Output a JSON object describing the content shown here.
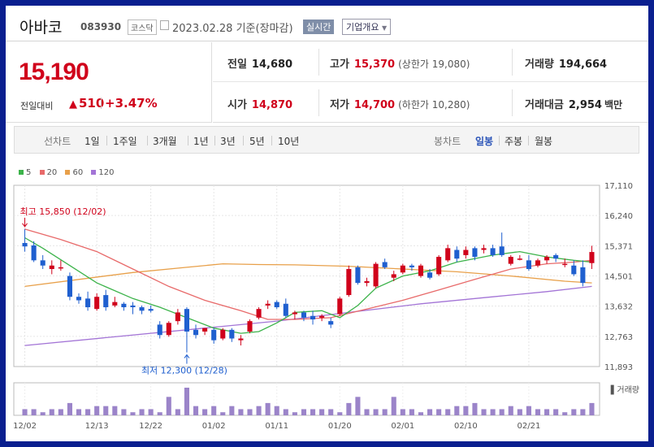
{
  "header": {
    "name": "아바코",
    "code": "083930",
    "market": "코스닥",
    "date": "2023.02.28",
    "basis": "기준(장마감)",
    "realtime_label": "실시간",
    "company_label": "기업개요"
  },
  "price": {
    "current": "15,190",
    "change_label": "전일대비",
    "change_value": "510",
    "change_percent": "+3.47%"
  },
  "stats": {
    "prev_close": {
      "label": "전일",
      "value": "14,680"
    },
    "high": {
      "label": "고가",
      "value": "15,370",
      "limit_label": "(상한가",
      "limit_value": "19,080)"
    },
    "volume": {
      "label": "거래량",
      "value": "194,664"
    },
    "open": {
      "label": "시가",
      "value": "14,870"
    },
    "low": {
      "label": "저가",
      "value": "14,700",
      "limit_label": "(하한가",
      "limit_value": "10,280)"
    },
    "trade_value": {
      "label": "거래대금",
      "value": "2,954",
      "unit": "백만"
    }
  },
  "tabs": {
    "line_label": "선차트",
    "periods": [
      "1일",
      "1주일",
      "3개월",
      "1년",
      "3년",
      "5년",
      "10년"
    ],
    "candle_label": "봉차트",
    "candles": [
      "일봉",
      "주봉",
      "월봉"
    ],
    "active_candle": "일봉"
  },
  "colors": {
    "up": "#d0021b",
    "down": "#1f5fcf",
    "ma5": "#3cb34a",
    "ma20": "#e86a6a",
    "ma60": "#e8a04a",
    "ma120": "#a374d6",
    "volume": "#9b84c9"
  },
  "chart_data": {
    "type": "candlestick",
    "legend": [
      "5",
      "20",
      "60",
      "120"
    ],
    "y_ticks": [
      "17,110",
      "16,240",
      "15,371",
      "14,501",
      "13,632",
      "12,763",
      "11,893"
    ],
    "ylim": [
      11893,
      17110
    ],
    "x_ticks": [
      "12/02",
      "12/13",
      "12/22",
      "01/02",
      "01/11",
      "01/20",
      "02/01",
      "02/10",
      "02/21"
    ],
    "volume_label": "거래량",
    "annotations": {
      "high": {
        "text": "최고 15,850 (12/02)",
        "value": 15850,
        "index": 0
      },
      "low": {
        "text": "최저 12,300 (12/28)",
        "value": 12300,
        "index": 18
      }
    },
    "candles": [
      {
        "o": 15450,
        "h": 15850,
        "l": 15200,
        "c": 15350
      },
      {
        "o": 15380,
        "h": 15500,
        "l": 14900,
        "c": 14950
      },
      {
        "o": 14950,
        "h": 15100,
        "l": 14700,
        "c": 14800
      },
      {
        "o": 14700,
        "h": 14950,
        "l": 14550,
        "c": 14800
      },
      {
        "o": 14750,
        "h": 14950,
        "l": 14650,
        "c": 14750
      },
      {
        "o": 14500,
        "h": 14600,
        "l": 13800,
        "c": 13900
      },
      {
        "o": 13900,
        "h": 14000,
        "l": 13700,
        "c": 13800
      },
      {
        "o": 13850,
        "h": 14050,
        "l": 13500,
        "c": 13600
      },
      {
        "o": 13550,
        "h": 14000,
        "l": 13500,
        "c": 13900
      },
      {
        "o": 13950,
        "h": 14100,
        "l": 13500,
        "c": 13600
      },
      {
        "o": 13650,
        "h": 13900,
        "l": 13600,
        "c": 13750
      },
      {
        "o": 13700,
        "h": 13750,
        "l": 13500,
        "c": 13600
      },
      {
        "o": 13650,
        "h": 13750,
        "l": 13400,
        "c": 13600
      },
      {
        "o": 13600,
        "h": 13650,
        "l": 13400,
        "c": 13500
      },
      {
        "o": 13550,
        "h": 13650,
        "l": 13450,
        "c": 13500
      },
      {
        "o": 13100,
        "h": 13200,
        "l": 12700,
        "c": 12800
      },
      {
        "o": 12800,
        "h": 13200,
        "l": 12750,
        "c": 13150
      },
      {
        "o": 13200,
        "h": 13550,
        "l": 13100,
        "c": 13450
      },
      {
        "o": 13550,
        "h": 13600,
        "l": 12300,
        "c": 12900
      },
      {
        "o": 12950,
        "h": 13100,
        "l": 12700,
        "c": 12800
      },
      {
        "o": 12900,
        "h": 13000,
        "l": 12800,
        "c": 13000
      },
      {
        "o": 12950,
        "h": 13000,
        "l": 12550,
        "c": 12650
      },
      {
        "o": 12700,
        "h": 13000,
        "l": 12650,
        "c": 12950
      },
      {
        "o": 12950,
        "h": 13000,
        "l": 12600,
        "c": 12700
      },
      {
        "o": 12650,
        "h": 12800,
        "l": 12500,
        "c": 12700
      },
      {
        "o": 12900,
        "h": 13250,
        "l": 12850,
        "c": 13200
      },
      {
        "o": 13300,
        "h": 13600,
        "l": 13250,
        "c": 13550
      },
      {
        "o": 13650,
        "h": 13800,
        "l": 13550,
        "c": 13700
      },
      {
        "o": 13750,
        "h": 13800,
        "l": 13550,
        "c": 13600
      },
      {
        "o": 13700,
        "h": 13850,
        "l": 13300,
        "c": 13350
      },
      {
        "o": 13400,
        "h": 13500,
        "l": 13250,
        "c": 13450
      },
      {
        "o": 13450,
        "h": 13500,
        "l": 13200,
        "c": 13300
      },
      {
        "o": 13350,
        "h": 13500,
        "l": 13100,
        "c": 13250
      },
      {
        "o": 13300,
        "h": 13400,
        "l": 13200,
        "c": 13350
      },
      {
        "o": 13200,
        "h": 13300,
        "l": 13000,
        "c": 13100
      },
      {
        "o": 13400,
        "h": 13900,
        "l": 13350,
        "c": 13850
      },
      {
        "o": 13950,
        "h": 14800,
        "l": 13900,
        "c": 14700
      },
      {
        "o": 14750,
        "h": 14800,
        "l": 14250,
        "c": 14300
      },
      {
        "o": 14300,
        "h": 14450,
        "l": 14200,
        "c": 14350
      },
      {
        "o": 14200,
        "h": 14900,
        "l": 14150,
        "c": 14850
      },
      {
        "o": 14900,
        "h": 15000,
        "l": 14700,
        "c": 14750
      },
      {
        "o": 14450,
        "h": 14650,
        "l": 14350,
        "c": 14550
      },
      {
        "o": 14600,
        "h": 14850,
        "l": 14550,
        "c": 14800
      },
      {
        "o": 14800,
        "h": 14850,
        "l": 14650,
        "c": 14750
      },
      {
        "o": 14500,
        "h": 14850,
        "l": 14450,
        "c": 14800
      },
      {
        "o": 14600,
        "h": 14700,
        "l": 14400,
        "c": 14450
      },
      {
        "o": 14550,
        "h": 15100,
        "l": 14500,
        "c": 15050
      },
      {
        "o": 14950,
        "h": 15400,
        "l": 14900,
        "c": 15300
      },
      {
        "o": 15250,
        "h": 15350,
        "l": 14900,
        "c": 15000
      },
      {
        "o": 15100,
        "h": 15350,
        "l": 15000,
        "c": 15250
      },
      {
        "o": 15300,
        "h": 15350,
        "l": 14950,
        "c": 15050
      },
      {
        "o": 15250,
        "h": 15400,
        "l": 15150,
        "c": 15300
      },
      {
        "o": 15300,
        "h": 15400,
        "l": 15050,
        "c": 15100
      },
      {
        "o": 15350,
        "h": 15750,
        "l": 15050,
        "c": 15100
      },
      {
        "o": 14850,
        "h": 15100,
        "l": 14800,
        "c": 15050
      },
      {
        "o": 15000,
        "h": 15100,
        "l": 14950,
        "c": 15000
      },
      {
        "o": 14950,
        "h": 15100,
        "l": 14650,
        "c": 14700
      },
      {
        "o": 14800,
        "h": 15000,
        "l": 14750,
        "c": 14950
      },
      {
        "o": 14950,
        "h": 15100,
        "l": 14850,
        "c": 15050
      },
      {
        "o": 15100,
        "h": 15150,
        "l": 14900,
        "c": 15000
      },
      {
        "o": 14850,
        "h": 15000,
        "l": 14750,
        "c": 14850
      },
      {
        "o": 14800,
        "h": 14950,
        "l": 14500,
        "c": 14550
      },
      {
        "o": 14750,
        "h": 14950,
        "l": 14200,
        "c": 14300
      },
      {
        "o": 14870,
        "h": 15370,
        "l": 14700,
        "c": 15190
      }
    ],
    "volume": [
      2,
      2,
      1,
      2,
      2,
      4,
      2,
      2,
      3,
      3,
      3,
      2,
      1,
      2,
      2,
      1,
      6,
      2,
      9,
      3,
      2,
      3,
      1,
      3,
      2,
      2,
      3,
      4,
      3,
      2,
      1,
      2,
      2,
      2,
      2,
      1,
      4,
      6,
      2,
      2,
      2,
      6,
      2,
      2,
      1,
      2,
      2,
      2,
      3,
      3,
      4,
      2,
      2,
      2,
      3,
      2,
      3,
      2,
      2,
      2,
      1,
      2,
      2,
      4
    ],
    "ma5": [
      [
        0,
        15600
      ],
      [
        2,
        15300
      ],
      [
        5,
        14800
      ],
      [
        8,
        14300
      ],
      [
        12,
        13850
      ],
      [
        15,
        13600
      ],
      [
        18,
        13300
      ],
      [
        21,
        13000
      ],
      [
        24,
        12850
      ],
      [
        26,
        12900
      ],
      [
        28,
        13150
      ],
      [
        30,
        13450
      ],
      [
        33,
        13500
      ],
      [
        35,
        13300
      ],
      [
        37,
        13650
      ],
      [
        39,
        14150
      ],
      [
        42,
        14500
      ],
      [
        45,
        14650
      ],
      [
        48,
        14900
      ],
      [
        52,
        15100
      ],
      [
        55,
        15200
      ],
      [
        58,
        15050
      ],
      [
        61,
        14950
      ],
      [
        63,
        14900
      ]
    ],
    "ma20": [
      [
        0,
        15850
      ],
      [
        4,
        15550
      ],
      [
        8,
        15200
      ],
      [
        12,
        14700
      ],
      [
        16,
        14200
      ],
      [
        20,
        13800
      ],
      [
        24,
        13500
      ],
      [
        27,
        13250
      ],
      [
        30,
        13250
      ],
      [
        34,
        13300
      ],
      [
        38,
        13550
      ],
      [
        42,
        13800
      ],
      [
        46,
        14100
      ],
      [
        50,
        14400
      ],
      [
        54,
        14700
      ],
      [
        58,
        14850
      ],
      [
        61,
        14900
      ],
      [
        63,
        14950
      ]
    ],
    "ma60": [
      [
        0,
        14200
      ],
      [
        6,
        14400
      ],
      [
        12,
        14600
      ],
      [
        18,
        14750
      ],
      [
        22,
        14850
      ],
      [
        26,
        14830
      ],
      [
        30,
        14820
      ],
      [
        36,
        14780
      ],
      [
        42,
        14700
      ],
      [
        48,
        14620
      ],
      [
        54,
        14500
      ],
      [
        60,
        14350
      ],
      [
        63,
        14300
      ]
    ],
    "ma120": [
      [
        0,
        12500
      ],
      [
        10,
        12750
      ],
      [
        20,
        13000
      ],
      [
        28,
        13200
      ],
      [
        36,
        13450
      ],
      [
        44,
        13700
      ],
      [
        52,
        13900
      ],
      [
        58,
        14050
      ],
      [
        63,
        14200
      ]
    ]
  }
}
